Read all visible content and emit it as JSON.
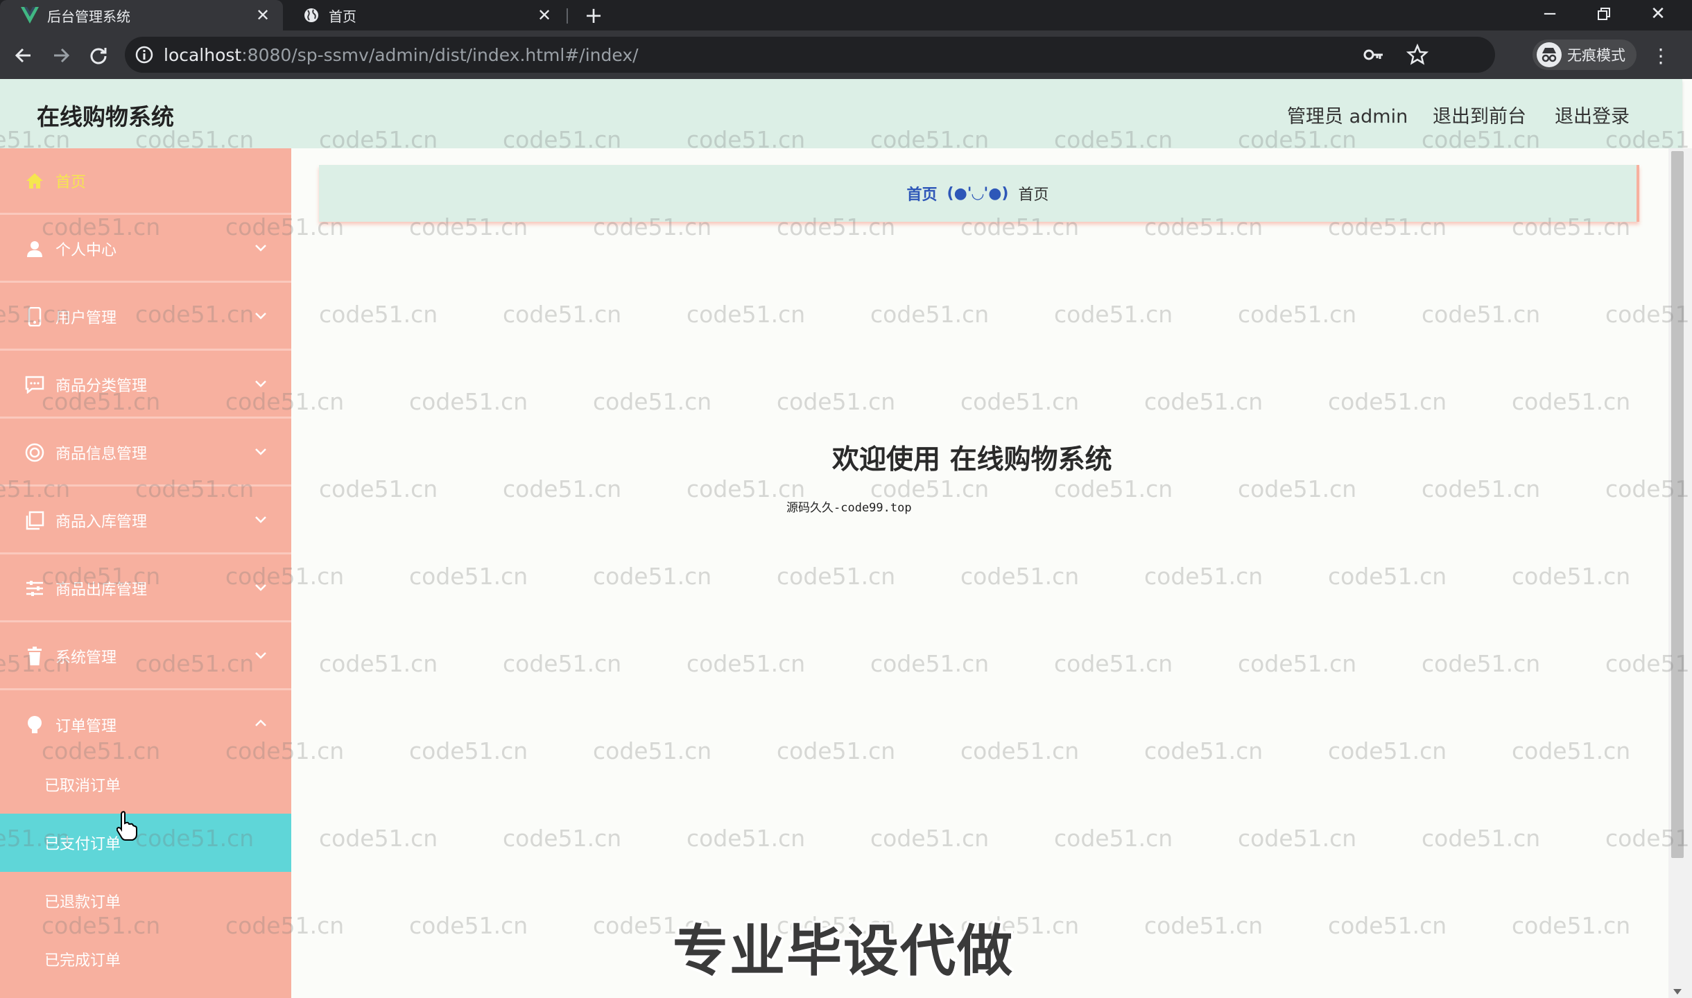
{
  "browser": {
    "tabs": [
      {
        "title": "后台管理系统",
        "icon": "vue-logo-icon",
        "active": true
      },
      {
        "title": "首页",
        "icon": "globe-icon",
        "active": false
      }
    ],
    "url_host": "localhost",
    "url_rest": ":8080/sp-ssmv/admin/dist/index.html#/index/",
    "incognito_label": "无痕模式"
  },
  "header": {
    "title": "在线购物系统",
    "admin_label": "管理员 admin",
    "front_link": "退出到前台",
    "logout_link": "退出登录"
  },
  "sidebar": {
    "items": [
      {
        "label": "首页",
        "icon": "home-icon"
      },
      {
        "label": "个人中心",
        "icon": "user-icon"
      },
      {
        "label": "用户管理",
        "icon": "phone-icon"
      },
      {
        "label": "商品分类管理",
        "icon": "chat-icon"
      },
      {
        "label": "商品信息管理",
        "icon": "target-icon"
      },
      {
        "label": "商品入库管理",
        "icon": "copy-icon"
      },
      {
        "label": "商品出库管理",
        "icon": "sliders-icon"
      },
      {
        "label": "系统管理",
        "icon": "trash-icon"
      },
      {
        "label": "订单管理",
        "icon": "bulb-icon"
      }
    ],
    "order_sub": [
      "已取消订单",
      "已支付订单",
      "已退款订单",
      "已完成订单"
    ]
  },
  "breadcrumb": {
    "home": "首页",
    "separator": "(●'◡'●)",
    "current": "首页"
  },
  "main": {
    "welcome": "欢迎使用 在线购物系统",
    "source_note": "源码久久-code99.top"
  },
  "overlay": {
    "promo": "专业毕设代做",
    "watermark": "code51.cn"
  },
  "colors": {
    "sidebar_bg": "#f7b09f",
    "header_bg": "#dcefe6",
    "selected_bg": "#5fd6d8",
    "active_text": "#f5e64f",
    "breadcrumb_link": "#2e57b8"
  }
}
